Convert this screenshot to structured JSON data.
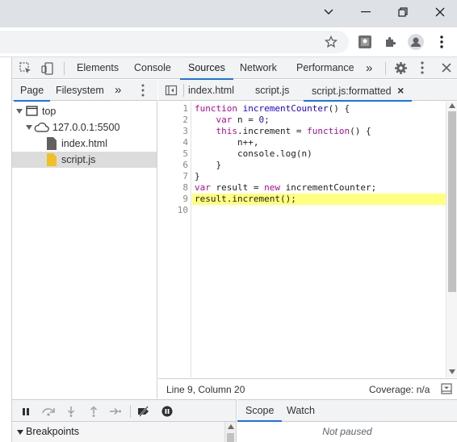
{
  "devtools": {
    "tabs": [
      "Elements",
      "Console",
      "Sources",
      "Network",
      "Performance"
    ],
    "active_tab": "Sources",
    "more_tabs": "»"
  },
  "navigator": {
    "tabs": [
      "Page",
      "Filesystem"
    ],
    "more": "»",
    "tree": [
      {
        "label": "top",
        "icon": "frame-icon"
      },
      {
        "label": "127.0.0.1:5500",
        "icon": "cloud-icon"
      },
      {
        "label": "index.html",
        "icon": "file-icon"
      },
      {
        "label": "script.js",
        "icon": "js-file-icon"
      }
    ]
  },
  "editor": {
    "tabs": [
      "index.html",
      "script.js",
      "script.js:formatted"
    ],
    "close_glyph": "×",
    "line_numbers": [
      "1",
      "2",
      "3",
      "4",
      "5",
      "6",
      "7",
      "8",
      "9",
      "10"
    ],
    "highlight_line": 9
  },
  "status": {
    "position": "Line 9, Column 20",
    "coverage": "Coverage: n/a"
  },
  "debugger": {
    "breakpoints_label": "Breakpoints",
    "scope_tabs": [
      "Scope",
      "Watch"
    ],
    "not_paused": "Not paused"
  },
  "colors": {
    "accent": "#1a73e8",
    "keyword": "#aa0d91",
    "highlight": "#ffff80"
  }
}
